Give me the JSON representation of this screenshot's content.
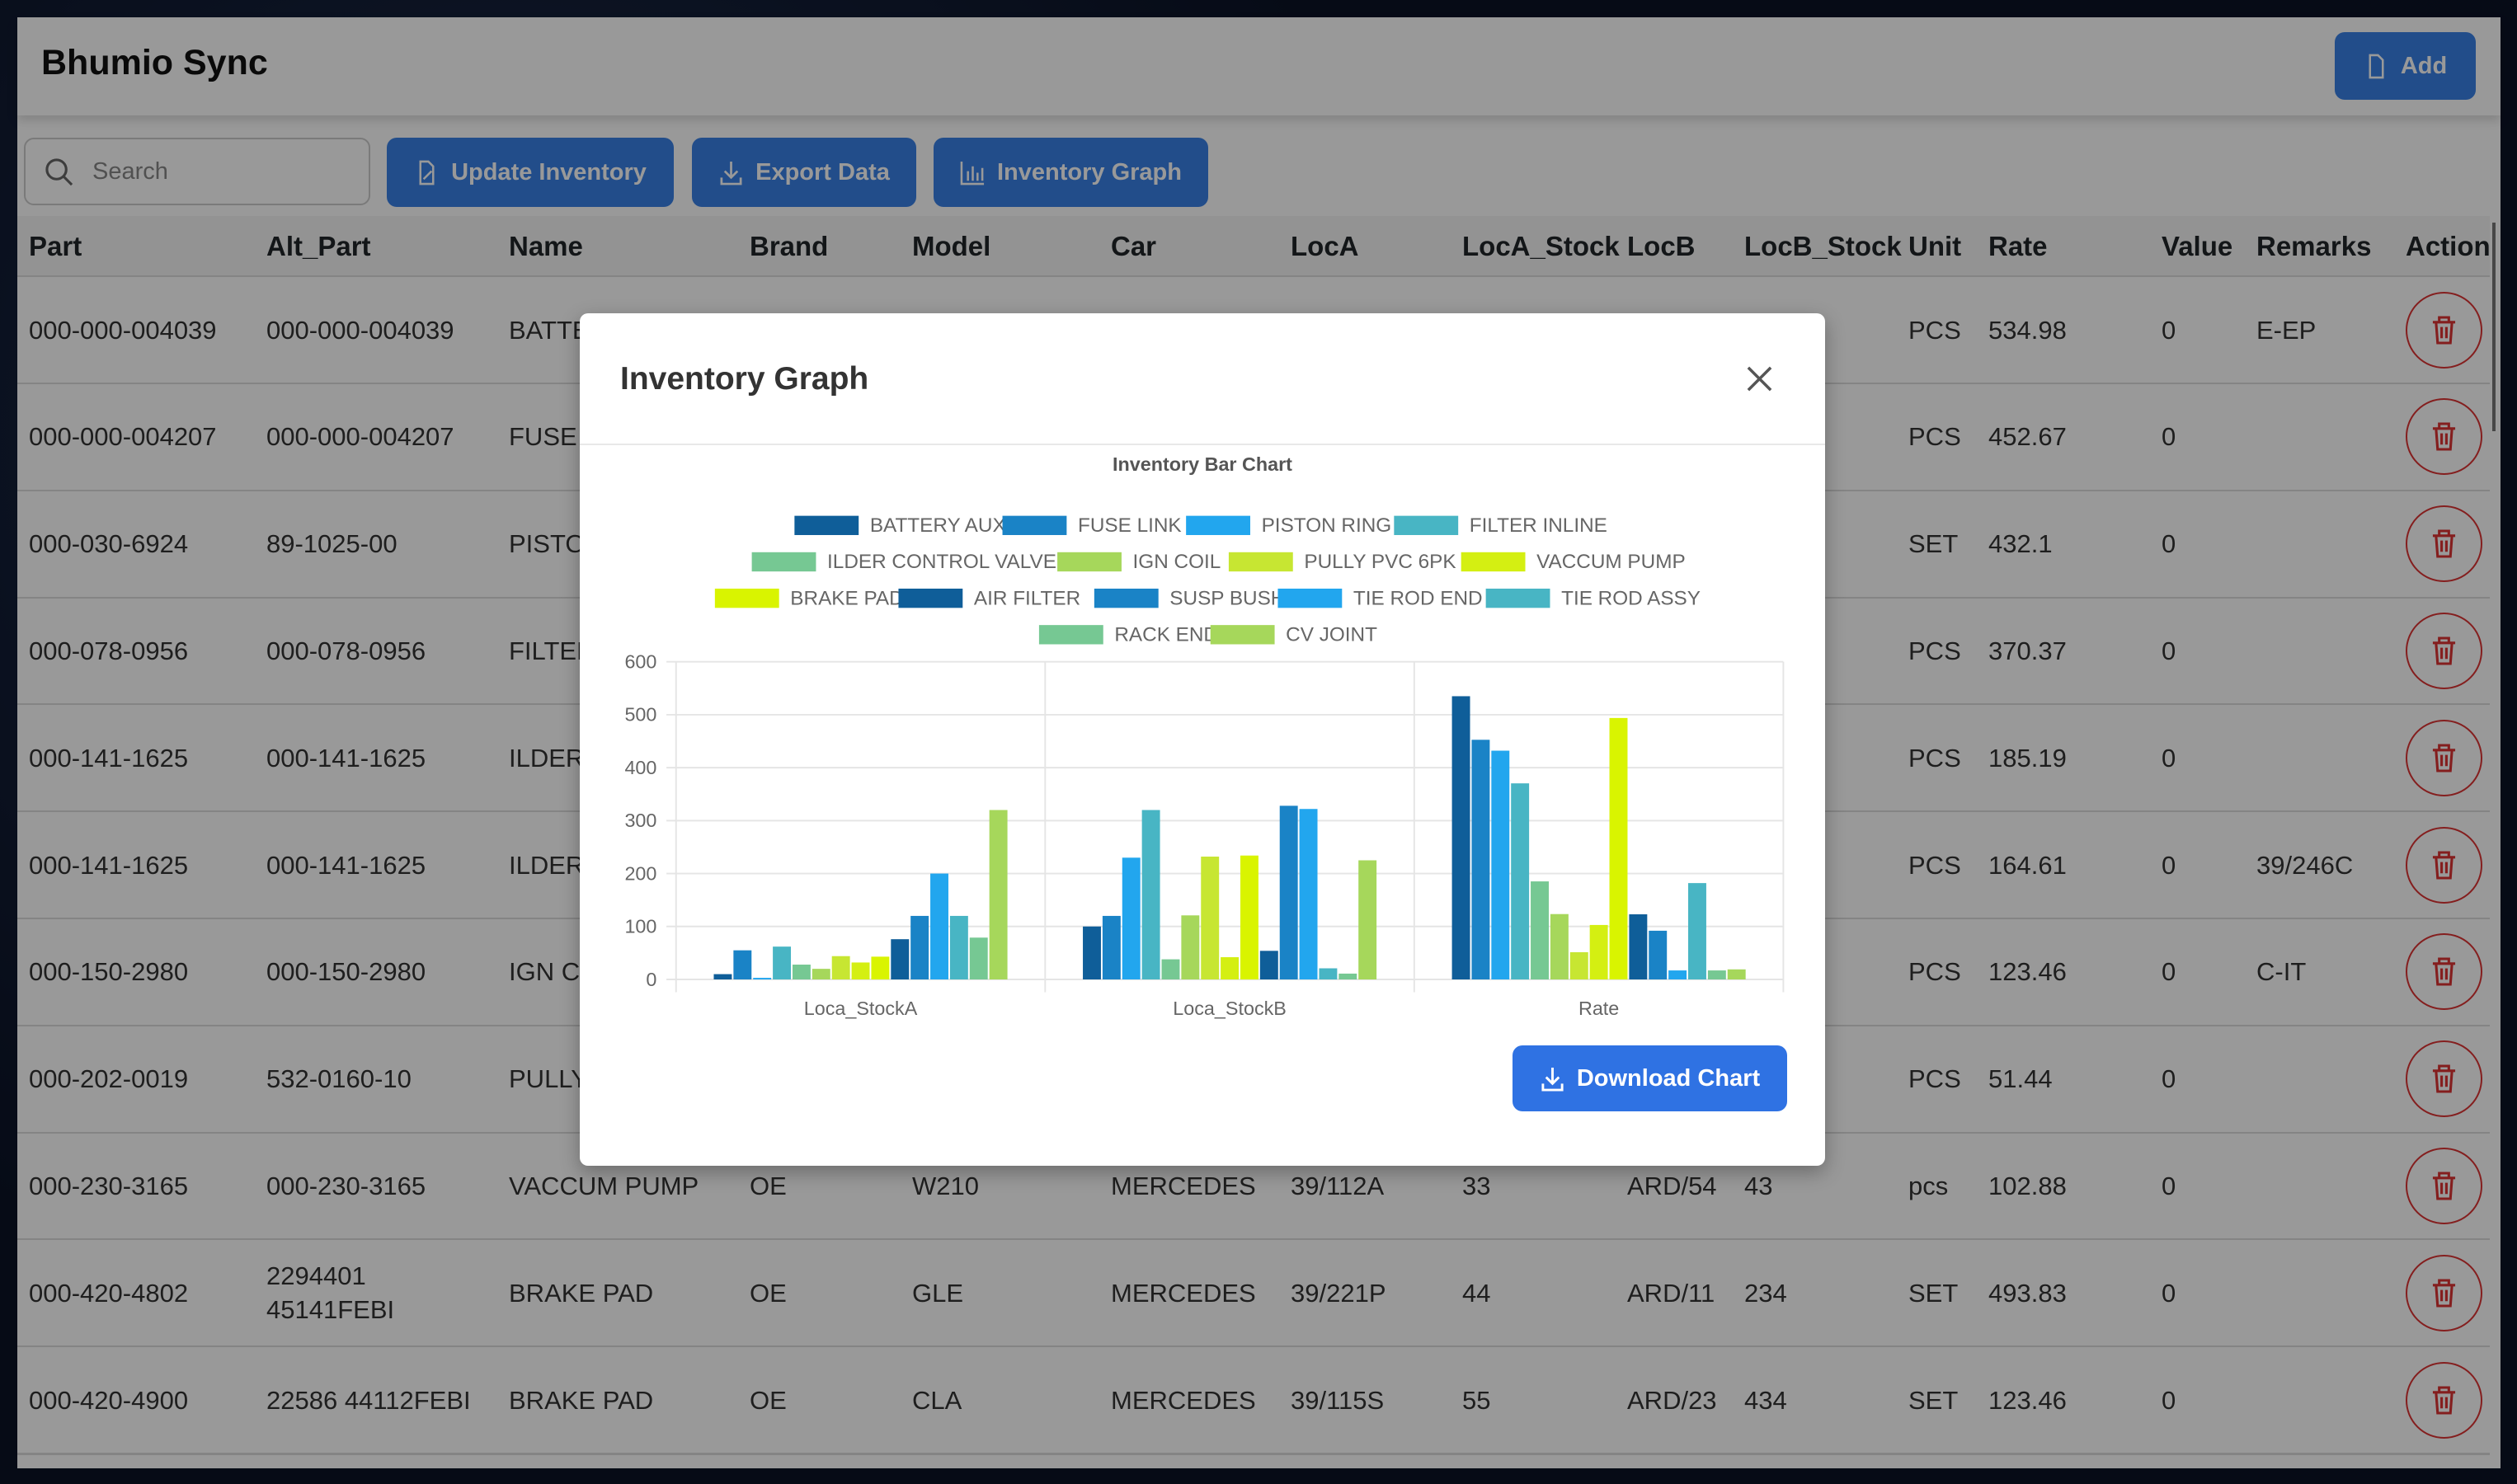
{
  "app": {
    "title": "Bhumio Sync",
    "add_label": "Add"
  },
  "toolbar": {
    "search_placeholder": "Search",
    "update_label": "Update Inventory",
    "export_label": "Export Data",
    "graph_label": "Inventory Graph"
  },
  "table": {
    "columns": [
      "Part",
      "Alt_Part",
      "Name",
      "Brand",
      "Model",
      "Car",
      "LocA",
      "LocA_Stock",
      "LocB",
      "LocB_Stock",
      "Unit",
      "Rate",
      "Value",
      "Remarks",
      "Action"
    ],
    "rows": [
      [
        "000-000-004039",
        "000-000-004039",
        "BATTE",
        "",
        "",
        "",
        "",
        "",
        "",
        "",
        "PCS",
        "534.98",
        "0",
        "E-EP"
      ],
      [
        "000-000-004207",
        "000-000-004207",
        "FUSE I",
        "",
        "",
        "",
        "",
        "",
        "",
        "",
        "PCS",
        "452.67",
        "0",
        ""
      ],
      [
        "000-030-6924",
        "89-1025-00",
        "PISTO",
        "",
        "",
        "",
        "",
        "",
        "",
        "",
        "SET",
        "432.1",
        "0",
        ""
      ],
      [
        "000-078-0956",
        "000-078-0956",
        "FILTER",
        "",
        "",
        "",
        "",
        "",
        "",
        "",
        "PCS",
        "370.37",
        "0",
        ""
      ],
      [
        "000-141-1625",
        "000-141-1625",
        "ILDER VALVE",
        "",
        "",
        "",
        "",
        "",
        "",
        "",
        "PCS",
        "185.19",
        "0",
        ""
      ],
      [
        "000-141-1625",
        "000-141-1625",
        "ILDER VALVE",
        "",
        "",
        "",
        "",
        "",
        "",
        "",
        "PCS",
        "164.61",
        "0",
        "39/246C"
      ],
      [
        "000-150-2980",
        "000-150-2980",
        "IGN C",
        "",
        "",
        "",
        "",
        "",
        "",
        "",
        "PCS",
        "123.46",
        "0",
        "C-IT"
      ],
      [
        "000-202-0019",
        "532-0160-10",
        "PULLY",
        "",
        "",
        "",
        "",
        "",
        "",
        "",
        "PCS",
        "51.44",
        "0",
        ""
      ],
      [
        "000-230-3165",
        "000-230-3165",
        "VACCUM PUMP",
        "OE",
        "W210",
        "MERCEDES",
        "39/112A",
        "33",
        "ARD/54",
        "43",
        "pcs",
        "102.88",
        "0",
        ""
      ],
      [
        "000-420-4802",
        "2294401 45141FEBI",
        "BRAKE PAD",
        "OE",
        "GLE",
        "MERCEDES",
        "39/221P",
        "44",
        "ARD/11",
        "234",
        "SET",
        "493.83",
        "0",
        ""
      ],
      [
        "000-420-4900",
        "22586 44112FEBI",
        "BRAKE PAD",
        "OE",
        "CLA",
        "MERCEDES",
        "39/115S",
        "55",
        "ARD/23",
        "434",
        "SET",
        "123.46",
        "0",
        ""
      ]
    ]
  },
  "modal": {
    "title": "Inventory Graph",
    "download_label": "Download Chart"
  },
  "colors": {
    "primary": "#3a80e6",
    "danger": "#d33"
  },
  "chart_data": {
    "type": "bar",
    "title": "Inventory Bar Chart",
    "categories": [
      "Loca_StockA",
      "Loca_StockB",
      "Rate"
    ],
    "ylim": [
      0,
      600
    ],
    "yticks": [
      0,
      100,
      200,
      300,
      400,
      500,
      600
    ],
    "grid": true,
    "legend": "top",
    "series": [
      {
        "name": "BATTERY AUX",
        "color": "#0f5e99",
        "values": [
          10,
          100,
          534.98
        ]
      },
      {
        "name": "FUSE LINK",
        "color": "#1a83c6",
        "values": [
          55,
          120,
          452.67
        ]
      },
      {
        "name": "PISTON RING",
        "color": "#22a6ee",
        "values": [
          3,
          230,
          432.1
        ]
      },
      {
        "name": "FILTER INLINE",
        "color": "#48b5c4",
        "values": [
          62,
          320,
          370.37
        ]
      },
      {
        "name": "ILDER CONTROL VALVE",
        "color": "#76c893",
        "values": [
          28,
          38,
          185.19
        ]
      },
      {
        "name": "IGN COIL",
        "color": "#a6d75b",
        "values": [
          20,
          121,
          123.46
        ]
      },
      {
        "name": "PULLY PVC 6PK",
        "color": "#c7e632",
        "values": [
          44,
          232,
          51.44
        ]
      },
      {
        "name": "VACCUM PUMP",
        "color": "#d4ef12",
        "values": [
          32,
          42,
          102.88
        ]
      },
      {
        "name": "BRAKE PAD",
        "color": "#d9f400",
        "values": [
          43,
          234,
          493.83
        ]
      },
      {
        "name": "AIR FILTER",
        "color": "#0f5e99",
        "values": [
          76,
          54,
          123
        ]
      },
      {
        "name": "SUSP BUSH",
        "color": "#1a83c6",
        "values": [
          120,
          328,
          92
        ]
      },
      {
        "name": "TIE ROD END",
        "color": "#22a6ee",
        "values": [
          200,
          322,
          17
        ]
      },
      {
        "name": "TIE ROD ASSY",
        "color": "#48b5c4",
        "values": [
          120,
          21,
          182
        ]
      },
      {
        "name": "RACK END",
        "color": "#76c893",
        "values": [
          79,
          11,
          17
        ]
      },
      {
        "name": "CV JOINT",
        "color": "#a6d75b",
        "values": [
          320,
          225,
          19
        ]
      }
    ]
  }
}
